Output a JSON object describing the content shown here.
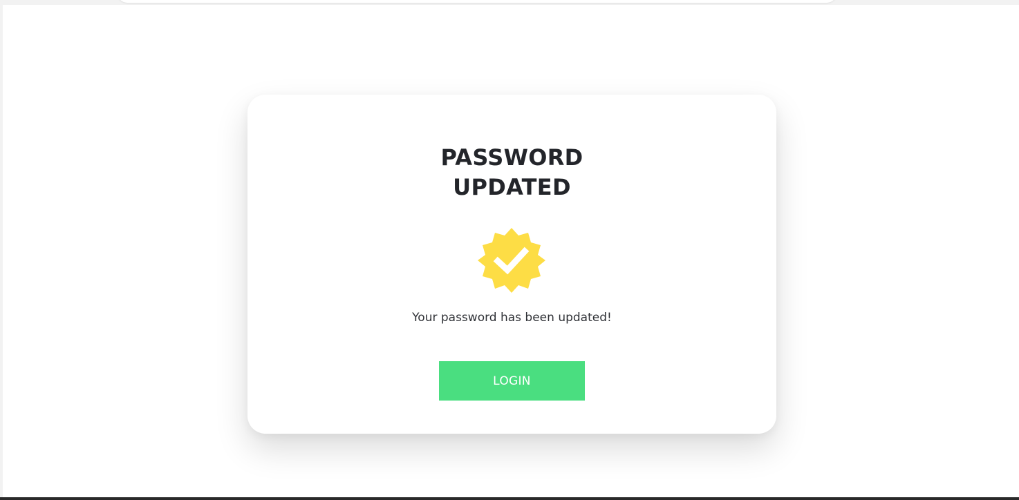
{
  "card": {
    "title_line1": "PASSWORD",
    "title_line2": "UPDATED",
    "badge_icon": "verified-check-badge-icon",
    "message": "Your password has been updated!",
    "login_label": "LOGIN"
  },
  "colors": {
    "badge": "#FDDD45",
    "button": "#4ADE80",
    "title_text": "#23252A",
    "body_text": "#2F3136"
  }
}
